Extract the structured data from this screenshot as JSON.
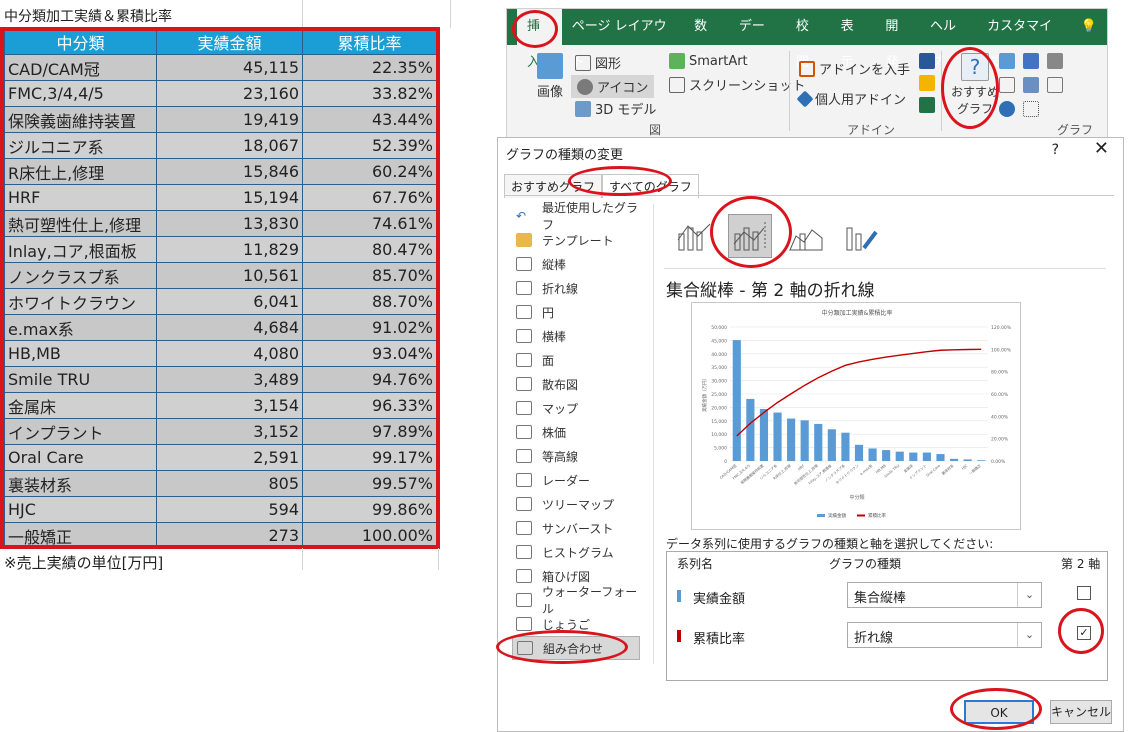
{
  "sheet": {
    "title": "中分類加工実績＆累積比率",
    "headers": [
      "中分類",
      "実績金額",
      "累積比率"
    ],
    "rows": [
      [
        "CAD/CAM冠",
        "45,115",
        "22.35%"
      ],
      [
        "FMC,3/4,4/5",
        "23,160",
        "33.82%"
      ],
      [
        "保険義歯維持装置",
        "19,419",
        "43.44%"
      ],
      [
        "ジルコニア系",
        "18,067",
        "52.39%"
      ],
      [
        "R床仕上,修理",
        "15,846",
        "60.24%"
      ],
      [
        "HRF",
        "15,194",
        "67.76%"
      ],
      [
        "熱可塑性仕上,修理",
        "13,830",
        "74.61%"
      ],
      [
        "Inlay,コア,根面板",
        "11,829",
        "80.47%"
      ],
      [
        "ノンクラスプ系",
        "10,561",
        "85.70%"
      ],
      [
        "ホワイトクラウン",
        "6,041",
        "88.70%"
      ],
      [
        "e.max系",
        "4,684",
        "91.02%"
      ],
      [
        "HB,MB",
        "4,080",
        "93.04%"
      ],
      [
        "Smile TRU",
        "3,489",
        "94.76%"
      ],
      [
        "金属床",
        "3,154",
        "96.33%"
      ],
      [
        "インプラント",
        "3,152",
        "97.89%"
      ],
      [
        "Oral Care",
        "2,591",
        "99.17%"
      ],
      [
        "裏装材系",
        "805",
        "99.57%"
      ],
      [
        "HJC",
        "594",
        "99.86%"
      ],
      [
        "一般矯正",
        "273",
        "100.00%"
      ]
    ],
    "note": "※売上実績の単位[万円]"
  },
  "ribbon": {
    "tabs": [
      "挿入",
      "ページ レイアウト",
      "数式",
      "データ",
      "校閲",
      "表示",
      "開発",
      "ヘルプ",
      "カスタマイズ"
    ],
    "image": "画像",
    "shapes": "図形",
    "icons": "アイコン",
    "model3d": "3D モデル",
    "smartart": "SmartArt",
    "screenshot": "スクリーンショット",
    "group_figure": "図",
    "get_addin": "アドインを入手",
    "personal_addin": "個人用アドイン",
    "group_addin": "アドイン",
    "recommended_chart": "おすすめ\nグラフ",
    "group_chart": "グラフ"
  },
  "dialog": {
    "title": "グラフの種類の変更",
    "help": "?",
    "close": "✕",
    "tab_recommended": "おすすめグラフ",
    "tab_all": "すべてのグラフ",
    "types": [
      "最近使用したグラフ",
      "テンプレート",
      "縦棒",
      "折れ線",
      "円",
      "横棒",
      "面",
      "散布図",
      "マップ",
      "株価",
      "等高線",
      "レーダー",
      "ツリーマップ",
      "サンバースト",
      "ヒストグラム",
      "箱ひげ図",
      "ウォーターフォール",
      "じょうご",
      "組み合わせ"
    ],
    "chart_heading": "集合縦棒 - 第 2 軸の折れ線",
    "series_caption": "データ系列に使用するグラフの種類と軸を選択してください:",
    "col_series": "系列名",
    "col_type": "グラフの種類",
    "col_axis": "第 2 軸",
    "series": [
      {
        "name": "実績金額",
        "type": "集合縦棒",
        "secondary": false,
        "color": "#5b9bd5"
      },
      {
        "name": "累積比率",
        "type": "折れ線",
        "secondary": true,
        "color": "#c00000"
      }
    ],
    "ok": "OK",
    "cancel": "キャンセル"
  },
  "chart_data": {
    "type": "bar",
    "title": "中分類加工実績&累積比率",
    "xlabel": "中分類",
    "ylabel": "実績金額（万円）",
    "categories": [
      "CAD/CAM冠",
      "FMC,3/4,4/5",
      "保険義歯維持装置",
      "ジルコニア系",
      "R床仕上,修理",
      "HRF",
      "熱可塑性仕上,修理",
      "Inlay,コア,根面板",
      "ノンクラスプ系",
      "ホワイトクラウン",
      "e.max系",
      "HB,MB",
      "Smile TRU",
      "金属床",
      "インプラント",
      "Oral Care",
      "裏装材系",
      "HJC",
      "一般矯正"
    ],
    "series": [
      {
        "name": "実績金額",
        "type": "bar",
        "values": [
          45115,
          23160,
          19419,
          18067,
          15846,
          15194,
          13830,
          11829,
          10561,
          6041,
          4684,
          4080,
          3489,
          3154,
          3152,
          2591,
          805,
          594,
          273
        ]
      },
      {
        "name": "累積比率",
        "type": "line",
        "axis": "secondary",
        "values": [
          22.35,
          33.82,
          43.44,
          52.39,
          60.24,
          67.76,
          74.61,
          80.47,
          85.7,
          88.7,
          91.02,
          93.04,
          94.76,
          96.33,
          97.89,
          99.17,
          99.57,
          99.86,
          100.0
        ]
      }
    ],
    "ylim": [
      0,
      50000
    ],
    "y2lim": [
      0,
      120
    ],
    "yticks": [
      "0",
      "5,000",
      "10,000",
      "15,000",
      "20,000",
      "25,000",
      "30,000",
      "35,000",
      "40,000",
      "45,000",
      "50,000"
    ],
    "y2ticks": [
      "0.00%",
      "20.00%",
      "40.00%",
      "60.00%",
      "80.00%",
      "100.00%",
      "120.00%"
    ],
    "grid": true,
    "legend": "bottom"
  }
}
